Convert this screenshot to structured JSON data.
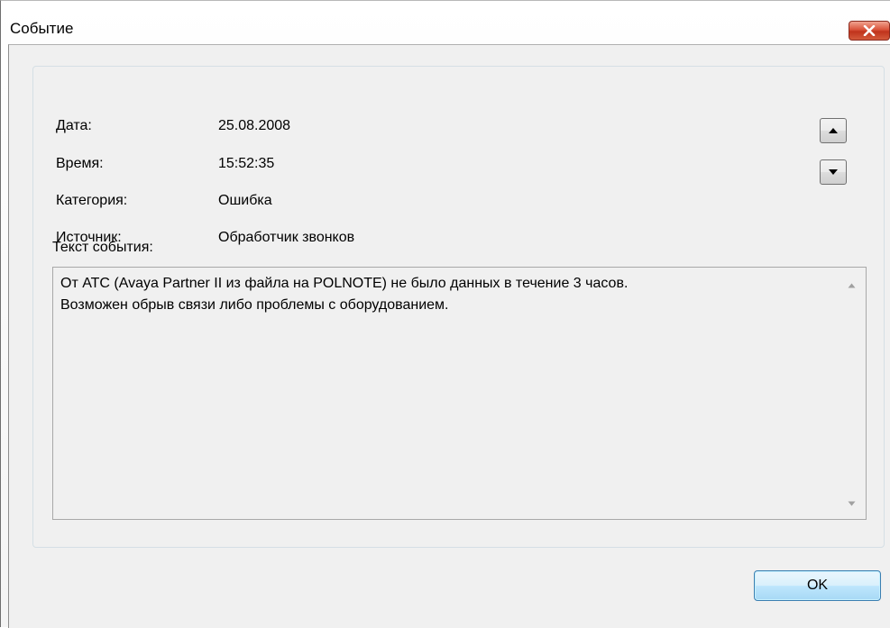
{
  "window": {
    "title": "Событие"
  },
  "fields": [
    {
      "label": "Дата:",
      "value": "25.08.2008"
    },
    {
      "label": "Время:",
      "value": "15:52:35"
    },
    {
      "label": "Категория:",
      "value": "Ошибка"
    },
    {
      "label": "Источник:",
      "value": "Обработчик звонков"
    }
  ],
  "event": {
    "label": "Текст события:",
    "text": "От АТС (Avaya Partner II из файла на POLNOTE) не было данных в течение 3 часов.\nВозможен обрыв связи либо проблемы с оборудованием."
  },
  "buttons": {
    "ok_label": "OK"
  },
  "icons": {
    "close": "close-icon",
    "up": "arrow-up-icon",
    "down": "arrow-down-icon"
  },
  "colors": {
    "close_button": "#c94a2e",
    "ok_border": "#3c7fb1",
    "client_bg": "#f0f0f0"
  }
}
